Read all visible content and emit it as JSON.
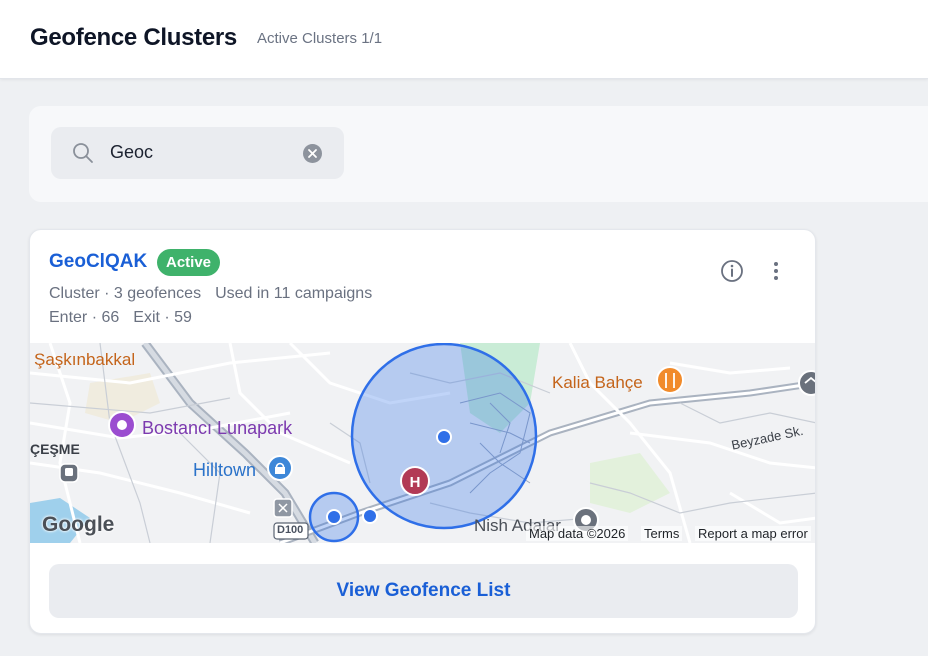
{
  "header": {
    "title": "Geofence Clusters",
    "subtitle": "Active Clusters 1/1"
  },
  "search": {
    "value": "Geoc",
    "icon": "search-icon",
    "clear_icon": "clear-icon"
  },
  "cluster": {
    "name": "GeoClQAK",
    "status": "Active",
    "status_color": "#3fb26b",
    "summary": "Cluster · 3 geofences",
    "campaigns": "Used in 11 campaigns",
    "enter": "Enter · 66",
    "exit": "Exit · 59",
    "actions": [
      "info-icon",
      "more-vertical-icon"
    ],
    "view_button": "View Geofence List"
  },
  "map": {
    "labels": {
      "saskinbakkal": "Şaşkınbakkal",
      "kalia": "Kalia Bahçe",
      "bostanci": "Bostancı Lunapark",
      "cesme": "ÇEŞME",
      "hilltown": "Hilltown",
      "beyzade": "Beyzade Sk.",
      "nish": "Nish Adalar",
      "road": "D100"
    },
    "footer": {
      "map_data": "Map data ©2026",
      "terms": "Terms",
      "report": "Report a map error"
    },
    "logo": "Google",
    "geofence_color": "#2f6fe8"
  }
}
